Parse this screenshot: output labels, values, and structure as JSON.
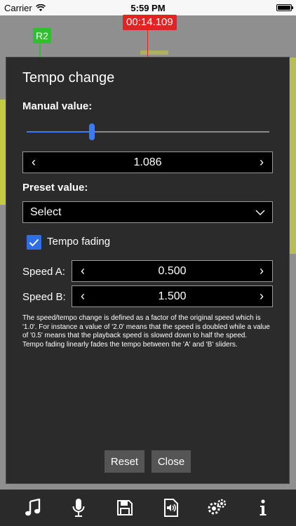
{
  "status_bar": {
    "carrier": "Carrier",
    "time": "5:59 PM",
    "battery_level": 1.0
  },
  "marker": {
    "label": "R2"
  },
  "playhead": {
    "time": "00:14.109"
  },
  "dialog": {
    "title": "Tempo change",
    "manual_label": "Manual value:",
    "manual_slider_value": 0.27,
    "manual_value": "1.086",
    "preset_label": "Preset value:",
    "preset_selected": "Select",
    "fading": {
      "checked": true,
      "label": "Tempo fading"
    },
    "speed_a": {
      "label": "Speed A:",
      "value": "0.500"
    },
    "speed_b": {
      "label": "Speed B:",
      "value": "1.500"
    },
    "help_text_1": "The speed/tempo change is defined as a factor of the original speed which is '1.0'. For instance a value of '2.0' means that the speed is doubled while a value of '0.5' means that the playback speed is slowed down to half the speed.",
    "help_text_2": "Tempo fading linearly fades the tempo between the 'A' and 'B' sliders.",
    "reset_label": "Reset",
    "close_label": "Close"
  },
  "toolbar": {
    "icons": [
      "music-icon",
      "microphone-icon",
      "save-icon",
      "audio-file-icon",
      "settings-icon",
      "info-icon"
    ]
  },
  "colors": {
    "accent": "#3d7bf2",
    "marker": "#2fbf2f",
    "playhead": "#e02424",
    "waveform": "#c8d23a"
  }
}
